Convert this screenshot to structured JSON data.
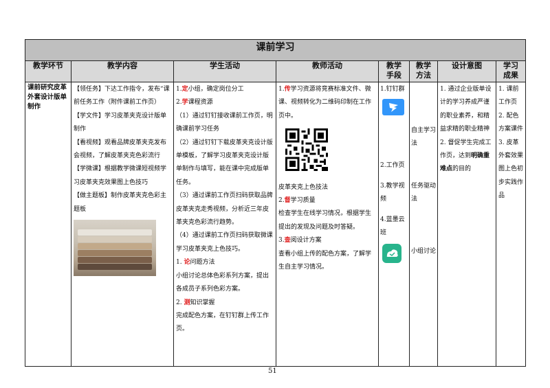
{
  "title": "课前学习",
  "headers": [
    "教学环节",
    "教学内容",
    "学生活动",
    "教师活动",
    "教学手段",
    "教学方法",
    "设计意图",
    "学习成果"
  ],
  "stage": "课前研究皮革外套设计版单制作",
  "content": [
    {
      "tag": "【领任务】",
      "text": "下达工作指令，发布“课前任务工作（附件课前工作页）"
    },
    {
      "tag": "【学文件】",
      "text": "学习皮革夹克设计版单制作"
    },
    {
      "tag": "【看视频】",
      "text": "观看品牌皮革夹克发布会视频，了解皮革夹克色彩流行"
    },
    {
      "tag": "【学微课】",
      "text": "根据教学微课短视频学习皮革夹克效果图上色技巧"
    },
    {
      "tag": "【做主题板】",
      "text": "制作皮革夹克色彩主题板"
    }
  ],
  "student": {
    "s1_pre": "1.",
    "s1_key": "定",
    "s1_text": "小组，确定岗位分工",
    "s2_pre": "2.",
    "s2_key": "学",
    "s2_text": "课程资源",
    "items": [
      "（1）通过钉钉接收课前工作页，明确课前学习任务",
      "（2）通过钉钉下载皮革夹克设计版单模板，了解学习皮革夹克设计版单制作与填写，能在课中完成版单任务。",
      "（3）通过课前工作页扫码获取品牌皮革夹克走秀视频，分析近三年皮革夹克色彩流行趋势。",
      "（4）通过课前工作页扫码获取微课学习皮革夹克上色技巧。"
    ],
    "s3_pre": "1.",
    "s3_key": "论",
    "s3_text": "问题方法",
    "s3_desc": "小组讨论总体色彩系列方案，提出各成员子系列色彩方案。",
    "s4_pre": "2.",
    "s4_key": "测",
    "s4_text": "知识掌握",
    "s4_desc": "完成配色方案，在钉钉群上传工作页。"
  },
  "teacher": {
    "t1_pre": "1.",
    "t1_key": "传",
    "t1_text": "学习资源将竞赛标准文件、微课、视频转化为二维码印制在工作页中。",
    "t1_caption": "皮革夹克上色技法",
    "t2_pre": "2.",
    "t2_key": "督",
    "t2_text": "学习质量",
    "t2_desc": "检查学生在线学习情况，根据学生提出的发现及问题及时答疑。",
    "t3_pre": "3.",
    "t3_key": "查",
    "t3_text": "阅设计方案",
    "t3_desc": "查看小组上传的配色方案，了解学生自主学习情况。"
  },
  "means": [
    "1.钉钉群",
    "2.工作页",
    "3.教学视频",
    "4.蓝墨云班"
  ],
  "methods": [
    "自主学习法",
    "任务驱动法",
    "小组讨论"
  ],
  "design": {
    "d1": "1. 通过企业版单设计的学习养成严谨的职业素养，和精益求精的职业精神",
    "d2_pre": "2. 督促学生完成工作页，达到",
    "d2_bold": "明确重难点",
    "d2_post": "的目的"
  },
  "outcomes": [
    "1. 课前工作页",
    "2. 配色方案课件",
    "3. 皮革外套效果图上色初步实践作品"
  ],
  "page_number": "51",
  "colors": {
    "title_bg": "#bfbfbf",
    "header_bg": "#d9d9d9",
    "key_red": "#e02020",
    "dingtalk_blue": "#3296fa",
    "cloud_teal": "#28b48c"
  },
  "icons": [
    "dingtalk-app-icon",
    "qr-code-icon",
    "mosoteach-app-icon",
    "leather-samples-photo"
  ]
}
